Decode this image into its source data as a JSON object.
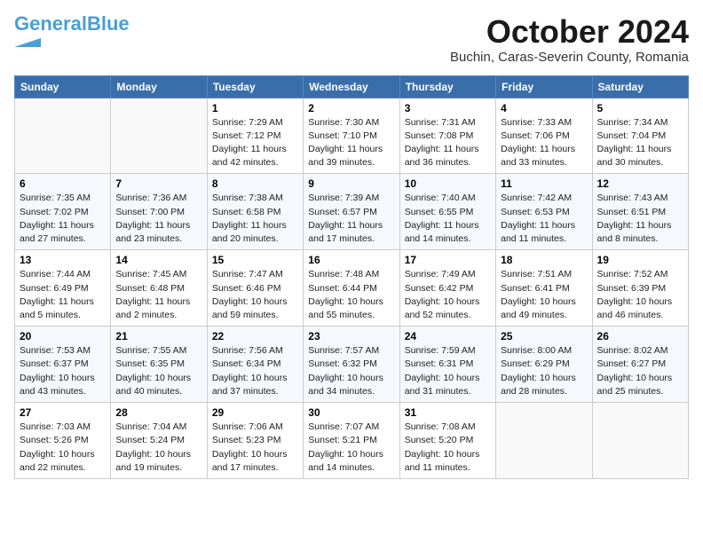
{
  "logo": {
    "line1": "General",
    "line2": "Blue",
    "tagline": ""
  },
  "header": {
    "month": "October 2024",
    "location": "Buchin, Caras-Severin County, Romania"
  },
  "weekdays": [
    "Sunday",
    "Monday",
    "Tuesday",
    "Wednesday",
    "Thursday",
    "Friday",
    "Saturday"
  ],
  "weeks": [
    [
      {
        "day": "",
        "info": ""
      },
      {
        "day": "",
        "info": ""
      },
      {
        "day": "1",
        "info": "Sunrise: 7:29 AM\nSunset: 7:12 PM\nDaylight: 11 hours and 42 minutes."
      },
      {
        "day": "2",
        "info": "Sunrise: 7:30 AM\nSunset: 7:10 PM\nDaylight: 11 hours and 39 minutes."
      },
      {
        "day": "3",
        "info": "Sunrise: 7:31 AM\nSunset: 7:08 PM\nDaylight: 11 hours and 36 minutes."
      },
      {
        "day": "4",
        "info": "Sunrise: 7:33 AM\nSunset: 7:06 PM\nDaylight: 11 hours and 33 minutes."
      },
      {
        "day": "5",
        "info": "Sunrise: 7:34 AM\nSunset: 7:04 PM\nDaylight: 11 hours and 30 minutes."
      }
    ],
    [
      {
        "day": "6",
        "info": "Sunrise: 7:35 AM\nSunset: 7:02 PM\nDaylight: 11 hours and 27 minutes."
      },
      {
        "day": "7",
        "info": "Sunrise: 7:36 AM\nSunset: 7:00 PM\nDaylight: 11 hours and 23 minutes."
      },
      {
        "day": "8",
        "info": "Sunrise: 7:38 AM\nSunset: 6:58 PM\nDaylight: 11 hours and 20 minutes."
      },
      {
        "day": "9",
        "info": "Sunrise: 7:39 AM\nSunset: 6:57 PM\nDaylight: 11 hours and 17 minutes."
      },
      {
        "day": "10",
        "info": "Sunrise: 7:40 AM\nSunset: 6:55 PM\nDaylight: 11 hours and 14 minutes."
      },
      {
        "day": "11",
        "info": "Sunrise: 7:42 AM\nSunset: 6:53 PM\nDaylight: 11 hours and 11 minutes."
      },
      {
        "day": "12",
        "info": "Sunrise: 7:43 AM\nSunset: 6:51 PM\nDaylight: 11 hours and 8 minutes."
      }
    ],
    [
      {
        "day": "13",
        "info": "Sunrise: 7:44 AM\nSunset: 6:49 PM\nDaylight: 11 hours and 5 minutes."
      },
      {
        "day": "14",
        "info": "Sunrise: 7:45 AM\nSunset: 6:48 PM\nDaylight: 11 hours and 2 minutes."
      },
      {
        "day": "15",
        "info": "Sunrise: 7:47 AM\nSunset: 6:46 PM\nDaylight: 10 hours and 59 minutes."
      },
      {
        "day": "16",
        "info": "Sunrise: 7:48 AM\nSunset: 6:44 PM\nDaylight: 10 hours and 55 minutes."
      },
      {
        "day": "17",
        "info": "Sunrise: 7:49 AM\nSunset: 6:42 PM\nDaylight: 10 hours and 52 minutes."
      },
      {
        "day": "18",
        "info": "Sunrise: 7:51 AM\nSunset: 6:41 PM\nDaylight: 10 hours and 49 minutes."
      },
      {
        "day": "19",
        "info": "Sunrise: 7:52 AM\nSunset: 6:39 PM\nDaylight: 10 hours and 46 minutes."
      }
    ],
    [
      {
        "day": "20",
        "info": "Sunrise: 7:53 AM\nSunset: 6:37 PM\nDaylight: 10 hours and 43 minutes."
      },
      {
        "day": "21",
        "info": "Sunrise: 7:55 AM\nSunset: 6:35 PM\nDaylight: 10 hours and 40 minutes."
      },
      {
        "day": "22",
        "info": "Sunrise: 7:56 AM\nSunset: 6:34 PM\nDaylight: 10 hours and 37 minutes."
      },
      {
        "day": "23",
        "info": "Sunrise: 7:57 AM\nSunset: 6:32 PM\nDaylight: 10 hours and 34 minutes."
      },
      {
        "day": "24",
        "info": "Sunrise: 7:59 AM\nSunset: 6:31 PM\nDaylight: 10 hours and 31 minutes."
      },
      {
        "day": "25",
        "info": "Sunrise: 8:00 AM\nSunset: 6:29 PM\nDaylight: 10 hours and 28 minutes."
      },
      {
        "day": "26",
        "info": "Sunrise: 8:02 AM\nSunset: 6:27 PM\nDaylight: 10 hours and 25 minutes."
      }
    ],
    [
      {
        "day": "27",
        "info": "Sunrise: 7:03 AM\nSunset: 5:26 PM\nDaylight: 10 hours and 22 minutes."
      },
      {
        "day": "28",
        "info": "Sunrise: 7:04 AM\nSunset: 5:24 PM\nDaylight: 10 hours and 19 minutes."
      },
      {
        "day": "29",
        "info": "Sunrise: 7:06 AM\nSunset: 5:23 PM\nDaylight: 10 hours and 17 minutes."
      },
      {
        "day": "30",
        "info": "Sunrise: 7:07 AM\nSunset: 5:21 PM\nDaylight: 10 hours and 14 minutes."
      },
      {
        "day": "31",
        "info": "Sunrise: 7:08 AM\nSunset: 5:20 PM\nDaylight: 10 hours and 11 minutes."
      },
      {
        "day": "",
        "info": ""
      },
      {
        "day": "",
        "info": ""
      }
    ]
  ]
}
